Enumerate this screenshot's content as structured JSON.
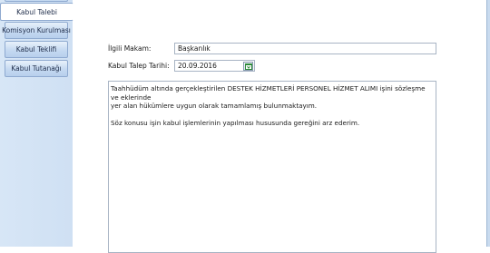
{
  "tabs": [
    {
      "label": "Kabul Talebi",
      "selected": true
    },
    {
      "label": "Komisyon Kurulması",
      "selected": false
    },
    {
      "label": "Kabul Teklifi",
      "selected": false
    },
    {
      "label": "Kabul Tutanağı",
      "selected": false
    }
  ],
  "form": {
    "makam_label": "İlgili Makam:",
    "makam_value": "Başkanlık",
    "tarih_label": "Kabul Talep Tarihi:",
    "tarih_value": "20.09.2016"
  },
  "memo": {
    "line1": "Taahhüdüm altında gerçekleştirilen DESTEK  HİZMETLERİ PERSONEL HİZMET ALIMI işini sözleşme ve eklerinde",
    "line2": "yer alan hükümlere uygun olarak tamamlamış bulunmaktayım.",
    "line3": "Söz konusu işin kabul işlemlerinin yapılması hususunda gereğini arz ederim."
  },
  "icons": {
    "date_picker": "calendar-icon"
  },
  "colors": {
    "tab_gradient_top": "#e8f1fb",
    "tab_gradient_bottom": "#b7cfec",
    "tab_border": "#8faad0",
    "strip_bg": "#d7e6f6",
    "calendar_green": "#2e8b3a"
  }
}
